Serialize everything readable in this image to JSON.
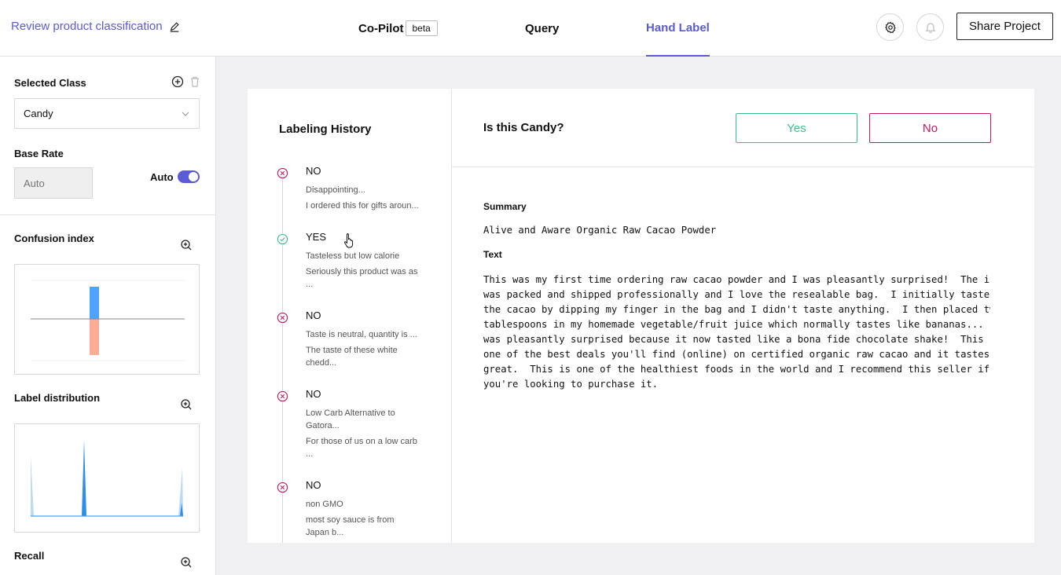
{
  "header": {
    "project_title": "Review product classification",
    "tabs": {
      "copilot": "Co-Pilot",
      "beta": "beta",
      "query": "Query",
      "hand_label": "Hand Label"
    },
    "share_label": "Share Project"
  },
  "sidebar": {
    "selected_class_label": "Selected Class",
    "selected_class_value": "Candy",
    "base_rate_label": "Base Rate",
    "base_rate_placeholder": "Auto",
    "auto_label": "Auto",
    "auto_enabled": true,
    "confusion_label": "Confusion index",
    "distribution_label": "Label distribution",
    "recall_label": "Recall"
  },
  "history": {
    "title": "Labeling History",
    "items": [
      {
        "verdict": "NO",
        "line1": "Disappointing...",
        "line2": "I ordered this for gifts aroun..."
      },
      {
        "verdict": "YES",
        "line1": "Tasteless but low calorie",
        "line2": "Seriously this product was as ..."
      },
      {
        "verdict": "NO",
        "line1": "Taste is neutral, quantity is ...",
        "line2": "The taste of these white chedd..."
      },
      {
        "verdict": "NO",
        "line1": "Low Carb Alternative to Gatora...",
        "line2": "For those of us on a low carb ..."
      },
      {
        "verdict": "NO",
        "line1": "non GMO",
        "line2": "most soy sauce is from Japan b..."
      }
    ]
  },
  "review": {
    "question": "Is this Candy?",
    "yes_label": "Yes",
    "no_label": "No",
    "summary_label": "Summary",
    "summary_value": "Alive and Aware Organic Raw Cacao Powder",
    "text_label": "Text",
    "text_value": "This was my first time ordering raw cacao powder and I was pleasantly surprised!  The item\nwas packed and shipped professionally and I love the resealable bag.  I initially tasted\nthe cacao by dipping my finger in the bag and I didn't taste anything.  I then placed two\ntablespoons in my homemade vegetable/fruit juice which normally tastes like bananas...  I\nwas pleasantly surprised because it now tasted like a bona fide chocolate shake!  This is\none of the best deals you'll find (online) on certified organic raw cacao and it tastes\ngreat.  This is one of the healthiest foods in the world and I recommend this seller if\nyou're looking to purchase it."
  },
  "colors": {
    "accent": "#5b5bd6",
    "yes": "#3cbf8a",
    "no": "#c7185e",
    "bar_pos": "#4da3ff",
    "bar_neg": "#ffab96"
  }
}
